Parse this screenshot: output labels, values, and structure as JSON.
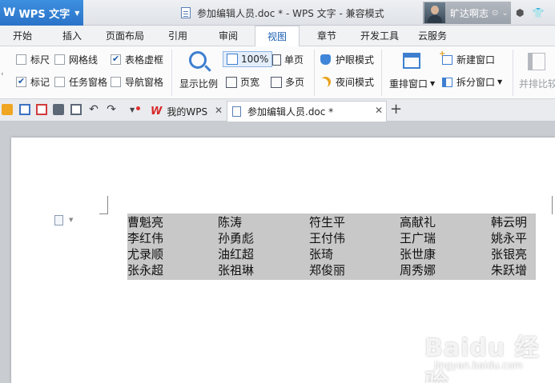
{
  "app": {
    "menu_label": "WPS 文字",
    "window_title": "参加编辑人员.doc * - WPS 文字 - 兼容模式",
    "user_name": "旷达啊志"
  },
  "menu_tabs": [
    "开始",
    "插入",
    "页面布局",
    "引用",
    "审阅",
    "视图",
    "章节",
    "开发工具",
    "云服务"
  ],
  "active_tab": "视图",
  "ribbon": {
    "ruler": "标尺",
    "gridlines": "网格线",
    "table_gridlines": "表格虚框",
    "marks": "标记",
    "task_pane": "任务窗格",
    "nav_pane": "导航窗格",
    "zoom_display": "显示比例",
    "zoom_value": "100%",
    "page_width": "页宽",
    "single_page": "单页",
    "multi_page": "多页",
    "eye_protect": "护眼模式",
    "night_mode": "夜间模式",
    "arrange_windows": "重排窗口",
    "new_window": "新建窗口",
    "split_window": "拆分窗口",
    "side_by_side": "并排比较"
  },
  "doc_tabs": {
    "home": "我的WPS",
    "document": "参加编辑人员.doc *"
  },
  "names": [
    [
      "曹魁亮",
      "陈涛",
      "符生平",
      "高献礼",
      "韩云明"
    ],
    [
      "李红伟",
      "孙勇彪",
      "王付伟",
      "王广瑞",
      "姚永平"
    ],
    [
      "尤录顺",
      "油红超",
      "张琦",
      "张世康",
      "张银亮"
    ],
    [
      "张永超",
      "张祖琳",
      "郑俊丽",
      "周秀娜",
      "朱跃增"
    ]
  ],
  "watermark": {
    "main": "Baidu 经验",
    "sub": "jingyan.baidu.com"
  }
}
